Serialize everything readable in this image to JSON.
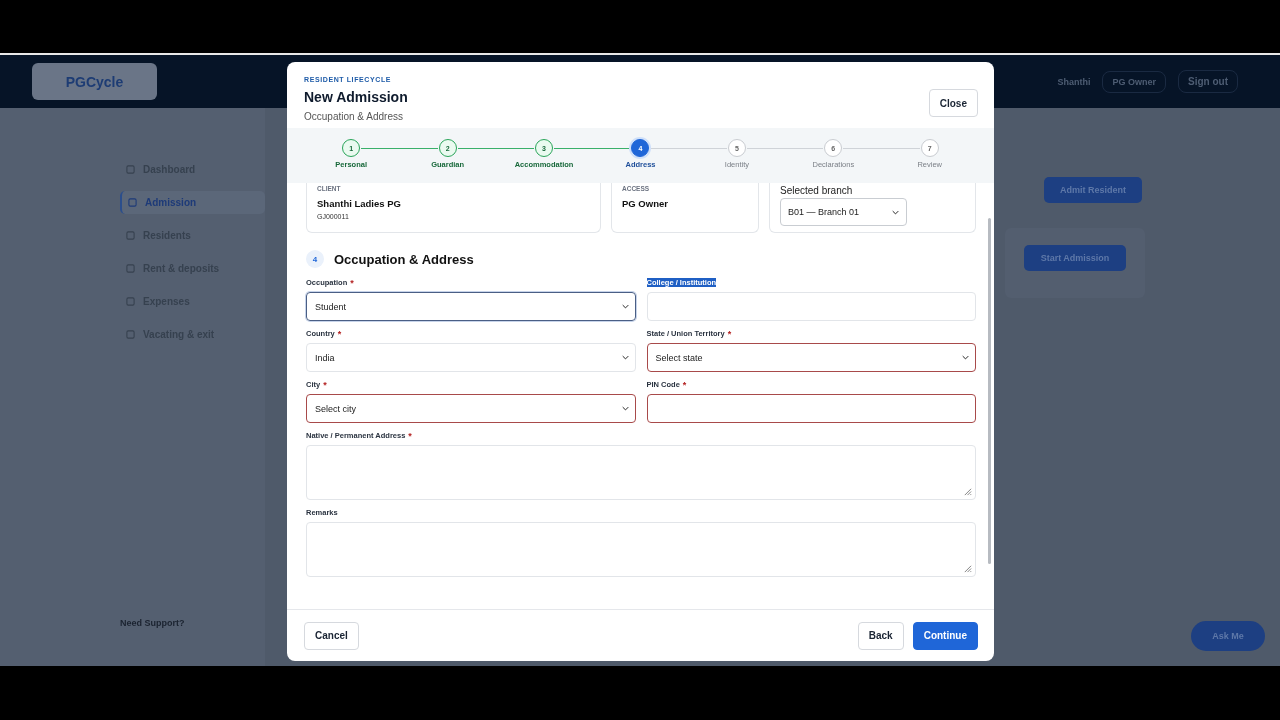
{
  "page": {
    "logo": "PGCycle",
    "user": "Shanthi",
    "role": "PG Owner",
    "sign_out": "Sign out",
    "nav": [
      {
        "label": "Dashboard",
        "selected": false
      },
      {
        "label": "Admission",
        "selected": true
      },
      {
        "label": "Residents",
        "selected": false
      },
      {
        "label": "Rent & deposits",
        "selected": false
      },
      {
        "label": "Expenses",
        "selected": false
      },
      {
        "label": "Vacating & exit",
        "selected": false
      }
    ],
    "support_title": "Need Support?",
    "actions": [
      "Admit Resident",
      "Start Admission"
    ],
    "assistant": "Ask Me"
  },
  "modal": {
    "eyebrow": "RESIDENT LIFECYCLE",
    "title": "New Admission",
    "subtitle": "Occupation & Address",
    "close": "Close",
    "steps": [
      {
        "number": "1",
        "label": "Personal",
        "done": true,
        "selected": false
      },
      {
        "number": "2",
        "label": "Guardian",
        "done": true,
        "selected": false
      },
      {
        "number": "3",
        "label": "Accommodation",
        "done": true,
        "selected": false
      },
      {
        "number": "4",
        "label": "Address",
        "done": false,
        "selected": true
      },
      {
        "number": "5",
        "label": "Identity",
        "done": false,
        "selected": false
      },
      {
        "number": "6",
        "label": "Declarations",
        "done": false,
        "selected": false
      },
      {
        "number": "7",
        "label": "Review",
        "done": false,
        "selected": false
      }
    ],
    "client": {
      "caption": "CLIENT",
      "name": "Shanthi Ladies PG",
      "code": "GJ000011"
    },
    "access": {
      "caption": "ACCESS",
      "role": "PG Owner"
    },
    "branch": {
      "label": "Selected branch",
      "value": "B01 — Branch 01"
    },
    "section": {
      "number": "4",
      "title": "Occupation & Address"
    },
    "fields": [
      {
        "kind": "select",
        "label": "Occupation",
        "required_mark": "*",
        "value": "Student",
        "invalid": false,
        "focused": true,
        "highlighted": false
      },
      {
        "kind": "input",
        "label": "College / Institution",
        "invalid": false,
        "focused": false,
        "highlighted": true
      },
      {
        "kind": "select",
        "label": "Country",
        "required_mark": "*",
        "value": "India",
        "invalid": false,
        "focused": false,
        "highlighted": false
      },
      {
        "kind": "select",
        "label": "State / Union Territory",
        "required_mark": "*",
        "placeholder": "Select state",
        "invalid": true,
        "focused": false,
        "highlighted": false
      },
      {
        "kind": "select",
        "label": "City",
        "required_mark": "*",
        "placeholder": "Select city",
        "invalid": true,
        "focused": false,
        "highlighted": false
      },
      {
        "kind": "input",
        "label": "PIN Code",
        "required_mark": "*",
        "invalid": true,
        "focused": false,
        "highlighted": false
      },
      {
        "kind": "textarea",
        "label": "Native / Permanent Address",
        "required_mark": "*",
        "invalid": false,
        "focused": false,
        "highlighted": false
      },
      {
        "kind": "textarea",
        "label": "Remarks",
        "invalid": false,
        "focused": false,
        "highlighted": false
      }
    ],
    "cancel": "Cancel",
    "back": "Back",
    "continue": "Continue"
  }
}
